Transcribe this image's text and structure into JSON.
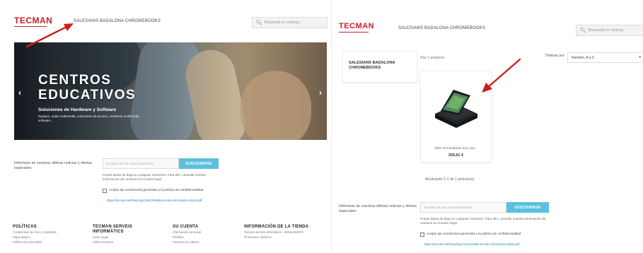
{
  "left": {
    "logo": "TECMAN",
    "store_title": "SALESIANS BADALONA CHROMEBOOKS",
    "search_placeholder": "Búsqueda en catálogo",
    "hero": {
      "title_line1": "CENTROS",
      "title_line2": "EDUCATIVOS",
      "subtitle": "Soluciones de Hardware y Software",
      "description": "Equipos, aulas multimedia, soluciones de acceso, cartelería multimedia, software...",
      "prev_arrow": "‹",
      "next_arrow": "›"
    },
    "newsletter": {
      "label": "Infórmese de nuestras últimas noticias y ofertas especiales",
      "input_placeholder": "Su dirección de correo electrónico",
      "button": "SUSCRIBIRSE",
      "note": "Puede darse de baja en cualquier momento. Para ello, consulte nuestra información de contacto en el aviso legal.",
      "consent": "Acepto las condiciones generales y la política de confidencialidad",
      "link": "https://tecman.net/shop/img/cms/151tabla-tecman-informacion-datos.pdf"
    },
    "footer": [
      {
        "heading": "POLÍTICAS",
        "links": [
          "Condiciones de Uso y Garantías",
          "Pago Seguro",
          "Política de privacidad"
        ]
      },
      {
        "heading": "TECMAN SERVEIS INFORMÀTICS",
        "links": [
          "Aviso Legal",
          "Sobre nosotros"
        ]
      },
      {
        "heading": "SU CUENTA",
        "links": [
          "Información personal",
          "Pedidos",
          "Facturas por abono"
        ]
      },
      {
        "heading": "INFORMACIÓN DE LA TIENDA",
        "links": [
          "Tecman Serveis Informàtics - ES061353470",
          "Pl Nacions Unides 6"
        ]
      }
    ]
  },
  "right": {
    "logo": "TECMAN",
    "store_title": "SALESIANS BADALONA CHROMEBOOKS",
    "search_placeholder": "Búsqueda en catálogo",
    "category": "SALESIANS BADALONA CHROMEBOOKS",
    "product_count": "Hay 1 producto.",
    "sort_label": "Ordenar por:",
    "sort_value": "Nombre, A a Z",
    "product": {
      "name": "300e Chromebook SAL 2nd...",
      "price": "359,91 €"
    },
    "showing": "Mostrando 1-1 de 1 artículo(s)",
    "newsletter": {
      "label": "Infórmese de nuestras últimas noticias y ofertas especiales",
      "input_placeholder": "Su dirección de correo electrónico",
      "button": "SUSCRIBIRSE",
      "note": "Puede darse de baja en cualquier momento. Para ello, consulte nuestra información de contacto en el aviso legal.",
      "consent": "Acepto las condiciones generales y la política de confidencialidad",
      "link": "https://tecman.net/shop/img/cms/151tabla-tecman-informacion-datos.pdf"
    }
  },
  "annotations": {
    "arrow_color": "#cc1f1f"
  },
  "icons": {
    "search": "search-icon",
    "checkbox": "checkbox-icon",
    "arrow": "red-arrow-icon"
  },
  "colors": {
    "brand": "#c8202a",
    "accent": "#5bc0de",
    "link": "#2a7fb8"
  }
}
